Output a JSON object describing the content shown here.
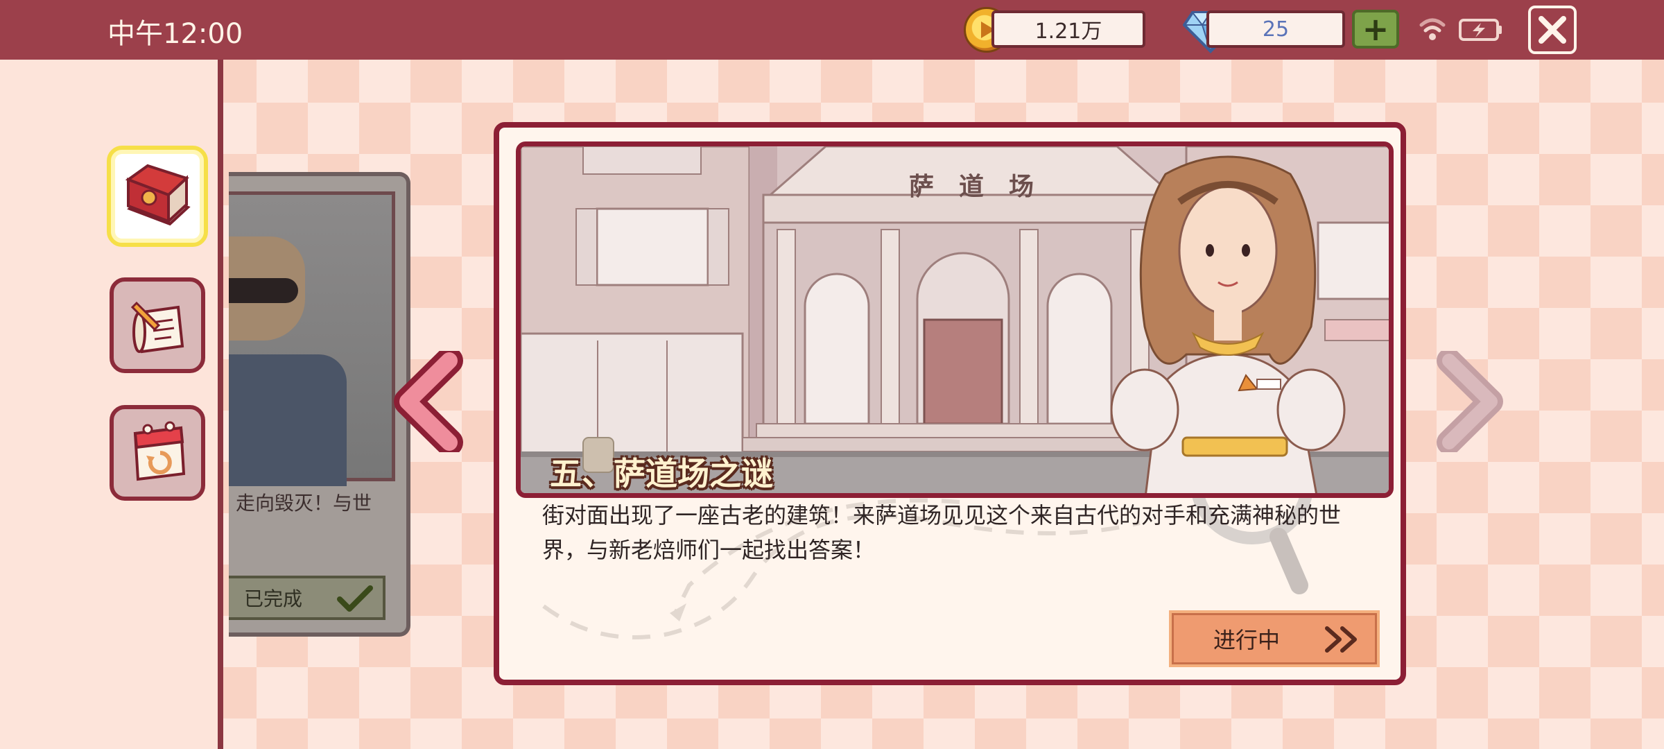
{
  "status_bar": {
    "time": "中午12:00"
  },
  "currency": {
    "coins": "1.21万",
    "gems": "25",
    "add_label": "+"
  },
  "icons": {
    "coin": "coin-icon",
    "gem": "diamond-icon",
    "signal": "wifi-icon",
    "battery": "battery-charging-icon",
    "close": "close-icon",
    "book": "book-icon",
    "scroll": "scroll-quill-icon",
    "calendar": "calendar-replay-icon",
    "prev": "chevron-left-icon",
    "next": "chevron-right-icon",
    "go": "double-chevron-right-icon"
  },
  "previous_chapter": {
    "description_fragment": "走向毁灭！与世",
    "status": "已完成"
  },
  "current_chapter": {
    "building_sign": "萨　道　场",
    "title": "五、萨道场之谜",
    "description": "街对面出现了一座古老的建筑！来萨道场见见这个来自古代的对手和充满神秘的世界，与新老焙师们一起找出答案！",
    "status": "进行中"
  },
  "colors": {
    "topbar": "#9c404b",
    "card_border": "#8c1f35",
    "active_tab": "#f6df48",
    "progress_button": "#ef9b70",
    "checker_light": "#fde7de",
    "checker_dark": "#f9d3c4"
  }
}
